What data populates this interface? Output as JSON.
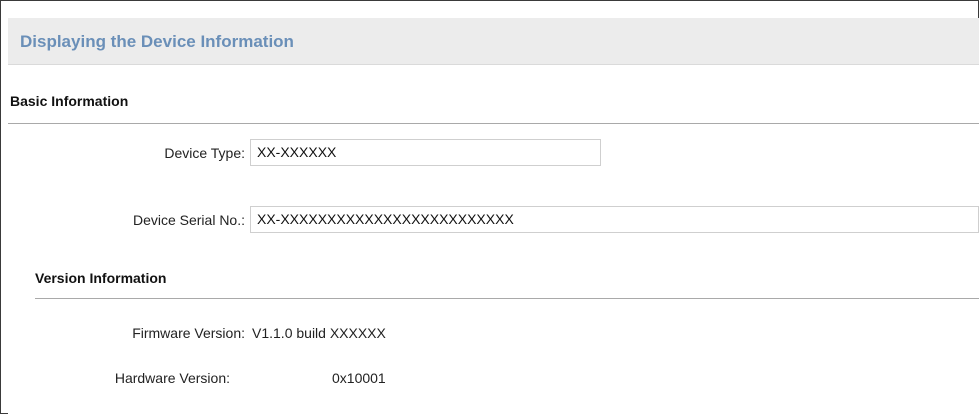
{
  "header": {
    "title": "Displaying the Device Information"
  },
  "basic_info": {
    "title": "Basic Information",
    "device_type": {
      "label": "Device Type:",
      "value": "XX-XXXXXX"
    },
    "device_serial": {
      "label": "Device Serial No.:",
      "value": "XX-XXXXXXXXXXXXXXXXXXXXXXXXX"
    }
  },
  "version_info": {
    "title": "Version Information",
    "firmware": {
      "label": "Firmware Version:",
      "value": "V1.1.0 build XXXXXX"
    },
    "hardware": {
      "label": "Hardware Version:",
      "value": "0x10001"
    }
  },
  "colors": {
    "header_background": "#ececec",
    "header_text": "#6a8fb8"
  }
}
